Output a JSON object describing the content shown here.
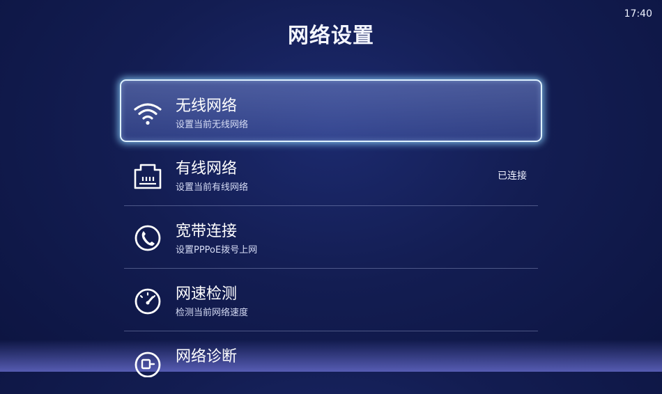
{
  "status_bar": {
    "time": "17:40"
  },
  "header": {
    "title": "网络设置"
  },
  "menu": {
    "items": [
      {
        "title": "无线网络",
        "subtitle": "设置当前无线网络",
        "status": "",
        "icon": "wifi-icon",
        "selected": true
      },
      {
        "title": "有线网络",
        "subtitle": "设置当前有线网络",
        "status": "已连接",
        "icon": "ethernet-icon"
      },
      {
        "title": "宽带连接",
        "subtitle": "设置PPPoE拨号上网",
        "status": "",
        "icon": "phone-icon"
      },
      {
        "title": "网速检测",
        "subtitle": "检测当前网络速度",
        "status": "",
        "icon": "speedometer-icon"
      },
      {
        "title": "网络诊断",
        "subtitle": "",
        "status": "",
        "icon": "diagnose-icon"
      }
    ]
  }
}
